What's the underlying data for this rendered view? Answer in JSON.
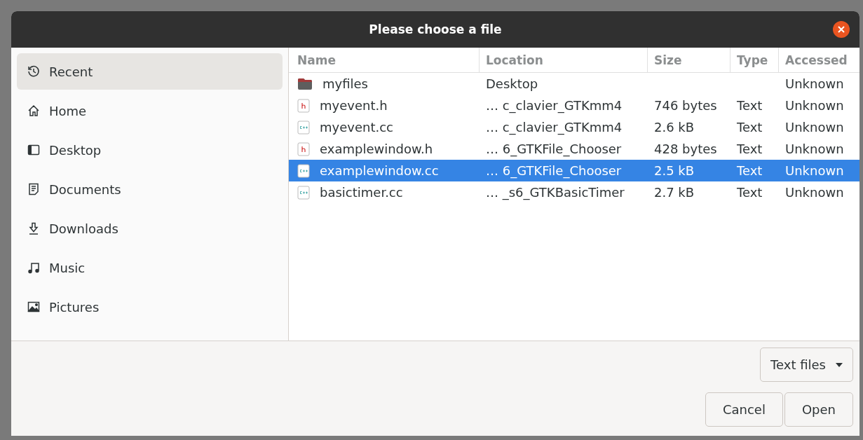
{
  "window": {
    "title": "Please choose a file"
  },
  "sidebar": {
    "items": [
      {
        "label": "Recent",
        "kind": "recent",
        "selected": true
      },
      {
        "label": "Home",
        "kind": "home",
        "selected": false
      },
      {
        "label": "Desktop",
        "kind": "desktop",
        "selected": false
      },
      {
        "label": "Documents",
        "kind": "documents",
        "selected": false
      },
      {
        "label": "Downloads",
        "kind": "downloads",
        "selected": false
      },
      {
        "label": "Music",
        "kind": "music",
        "selected": false
      },
      {
        "label": "Pictures",
        "kind": "pictures",
        "selected": false
      }
    ]
  },
  "table": {
    "columns": [
      "Name",
      "Location",
      "Size",
      "Type",
      "Accessed"
    ],
    "rows": [
      {
        "kind": "folder",
        "name": "myfiles",
        "location": "Desktop",
        "size": "",
        "type": "",
        "accessed": "Unknown",
        "selected": false
      },
      {
        "kind": "h",
        "name": "myevent.h",
        "location": "…  c_clavier_GTKmm4",
        "size": "746 bytes",
        "type": "Text",
        "accessed": "Unknown",
        "selected": false
      },
      {
        "kind": "cpp",
        "name": "myevent.cc",
        "location": "…  c_clavier_GTKmm4",
        "size": "2.6 kB",
        "type": "Text",
        "accessed": "Unknown",
        "selected": false
      },
      {
        "kind": "h",
        "name": "examplewindow.h",
        "location": "… 6_GTKFile_Chooser",
        "size": "428 bytes",
        "type": "Text",
        "accessed": "Unknown",
        "selected": false
      },
      {
        "kind": "cpp",
        "name": "examplewindow.cc",
        "location": "… 6_GTKFile_Chooser",
        "size": "2.5 kB",
        "type": "Text",
        "accessed": "Unknown",
        "selected": true
      },
      {
        "kind": "cpp",
        "name": "basictimer.cc",
        "location": "… _s6_GTKBasicTimer",
        "size": "2.7 kB",
        "type": "Text",
        "accessed": "Unknown",
        "selected": false
      }
    ]
  },
  "filter": {
    "label": "Text files"
  },
  "buttons": [
    "Cancel",
    "Open"
  ]
}
